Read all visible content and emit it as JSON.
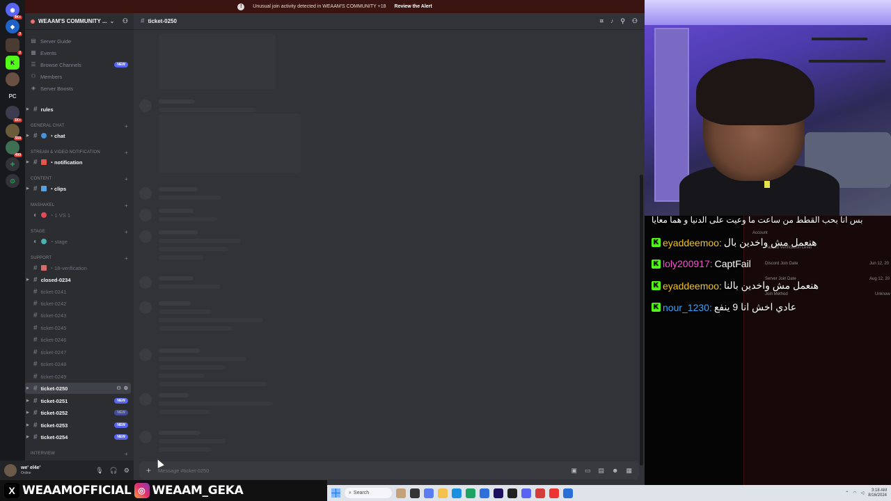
{
  "alert": {
    "text": "Unusual join activity detected in WEAAM'S COMMUNITY +18",
    "action": "Review the Alert"
  },
  "server_rail": {
    "badges": [
      "9K+",
      "3",
      "2",
      "1K+",
      "559",
      "499"
    ],
    "pc_label": "PC"
  },
  "guild": {
    "name": "WEAAM'S COMMUNITY ..."
  },
  "nav": [
    {
      "label": "Server Guide",
      "icon": "book-icon"
    },
    {
      "label": "Events",
      "icon": "calendar-icon"
    },
    {
      "label": "Browse Channels",
      "icon": "browse-icon",
      "badge": "NEW"
    },
    {
      "label": "Members",
      "icon": "members-icon"
    },
    {
      "label": "Server Boosts",
      "icon": "boost-icon"
    }
  ],
  "categories": {
    "general_chat": "GENERAL CHAT",
    "stream": "STREAM & VIDEO NOTIFICATION",
    "content": "CONTENT",
    "mashakel": "MASHAKEL",
    "stage": "STAGE",
    "support": "SUPPORT",
    "interview": "INTERVIEW"
  },
  "channels": {
    "rules": "rules",
    "chat": "・chat",
    "notification": "・notification",
    "clips": "・clips",
    "one_vs_one": "・1 VS 1",
    "stage": "・stage",
    "verification": "・18-verification",
    "closed": "closed-0234",
    "tickets_dim": [
      "ticket-0241",
      "ticket-0242",
      "ticket-0243",
      "ticket-0245",
      "ticket-0246",
      "ticket-0247",
      "ticket-0248",
      "ticket-0249"
    ],
    "selected": "ticket-0250",
    "tickets_new": [
      "ticket-0251",
      "ticket-0252",
      "ticket-0253",
      "ticket-0254"
    ],
    "new_label": "NEW"
  },
  "user": {
    "name": "we' el4e'",
    "status": "Online"
  },
  "chat": {
    "channel": "ticket-0250",
    "placeholder": "Message #ticket-0250"
  },
  "stream_chat": [
    {
      "user": "",
      "message": "بس انا بحب القطط من ساعت ما وعيت على الدنيا و هما معايا",
      "color": "#ffffff"
    },
    {
      "user": "eyaddeemoo:",
      "message": "هنعمل مش واخدين بال",
      "color": "#f5c518"
    },
    {
      "user": "loly200917:",
      "message": "CaptFail",
      "color": "#ff4fd8"
    },
    {
      "user": "eyaddeemoo:",
      "message": "هنعمل مش واخدين بالنا",
      "color": "#f5c518"
    },
    {
      "user": "nour_1230:",
      "message": "عادي اخش انا 9 ينفع",
      "color": "#33a6ff"
    }
  ],
  "ghost_panel": {
    "account": "Account",
    "verification": "Passed Verification Level",
    "discord_join": "Discord Join Date",
    "server_join": "Server Join Date",
    "join_method": "Join Method",
    "date1": "Jun 12, 20",
    "date2": "Aug 12, 20",
    "unknown": "Unknow"
  },
  "socials": {
    "x_handle": "WEAAMOFFICIAL",
    "ig_handle": "WEAAM_GEKA"
  },
  "taskbar": {
    "search": "Search",
    "time": "3:18 AM",
    "date": "8/16/2024"
  }
}
